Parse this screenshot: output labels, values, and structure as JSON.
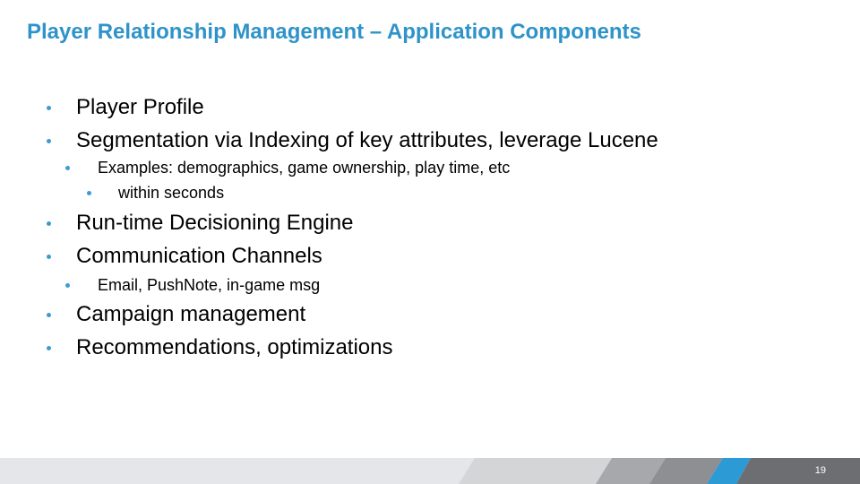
{
  "slide": {
    "title": "Player Relationship Management – Application Components",
    "page_number": "19",
    "accent_color": "#2e93c9",
    "bullets": [
      {
        "level": 1,
        "text": "Player Profile"
      },
      {
        "level": 1,
        "text": "Segmentation via Indexing of key attributes, leverage Lucene"
      },
      {
        "level": 2,
        "text": "Examples: demographics, game ownership, play time, etc"
      },
      {
        "level": 3,
        "text": "within seconds"
      },
      {
        "level": 1,
        "text": "Run-time Decisioning Engine"
      },
      {
        "level": 1,
        "text": "Communication Channels"
      },
      {
        "level": 2,
        "text": "Email, PushNote, in-game msg"
      },
      {
        "level": 1,
        "text": "Campaign management"
      },
      {
        "level": 1,
        "text": "Recommendations, optimizations"
      }
    ]
  },
  "footer": {
    "band_colors": [
      "#e5e6ea",
      "#d4d5d6",
      "#a7a8ab",
      "#8e8f92",
      "#2b9ad5",
      "#6d6e71"
    ]
  }
}
